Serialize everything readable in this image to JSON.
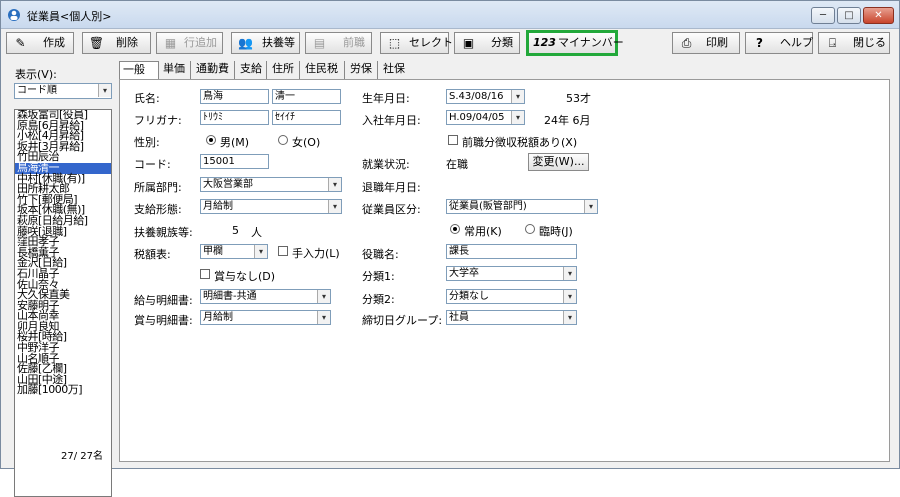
{
  "window": {
    "title": "従業員<個人別>",
    "min": "─",
    "max": "□",
    "close": "✕"
  },
  "toolbar": {
    "create": "作成",
    "delete": "削除",
    "add_row": "行追加",
    "dependents": "扶養等",
    "prev_job": "前職",
    "select": "セレクト",
    "category": "分類",
    "mynumber": "マイナンバー",
    "mynumber_icon": "123",
    "print": "印刷",
    "help": "ヘルプ",
    "close": "閉じる"
  },
  "left": {
    "display_label": "表示(V):",
    "sort_value": "コード順",
    "count": "27/ 27名",
    "employees": [
      "森坂富司[役員]",
      "原島[6月昇給]",
      "小松[4月昇給]",
      "坂井[3月昇給]",
      "竹田辰治",
      "鳥海清一",
      "中村[休職(有)]",
      "田所耕太郎",
      "竹下[郵便局]",
      "坂本[休職(無)]",
      "萩原[日給月給]",
      "藤咲[退職]",
      "窪田孝子",
      "長橋薫子",
      "金沢[日給]",
      "石川晶子",
      "佐山奈々",
      "大久保直美",
      "安藤明子",
      "山本尚幸",
      "卯月良知",
      "桜井[時給]",
      "中野洋子",
      "山名順子",
      "佐藤[乙欄]",
      "山田[中途]",
      "加藤[1000万]"
    ],
    "selected_index": 5
  },
  "tabs": [
    "一般",
    "単価",
    "通勤費",
    "支給",
    "住所",
    "住民税",
    "労保",
    "社保"
  ],
  "form": {
    "name_label": "氏名:",
    "last_name": "鳥海",
    "first_name": "清一",
    "kana_label": "フリガナ:",
    "last_kana": "ﾄﾘｳﾐ",
    "first_kana": "ｾｲｲﾁ",
    "sex_label": "性別:",
    "male": "男(M)",
    "female": "女(O)",
    "code_label": "コード:",
    "code": "15001",
    "dept_label": "所属部門:",
    "dept": "大阪営業部",
    "pay_form_label": "支給形態:",
    "pay_form": "月給制",
    "dep_label": "扶養親族等:",
    "dep_count": "5",
    "dep_unit": "人",
    "tax_label": "税額表:",
    "tax": "甲欄",
    "manual_input": "手入力(L)",
    "no_bonus": "賞与なし(D)",
    "slip_label": "給与明細書:",
    "slip": "明細書-共通",
    "bonus_slip_label": "賞与明細書:",
    "bonus_slip": "月給制",
    "birth_label": "生年月日:",
    "birth": "S.43/08/16",
    "age": "53才",
    "join_label": "入社年月日:",
    "join": "H.09/04/05",
    "tenure": "24年 6月",
    "prev_tax": "前職分徴収税額あり(X)",
    "status_label": "就業状況:",
    "status": "在職",
    "change_btn": "変更(W)...",
    "retire_label": "退職年月日:",
    "emp_class_label": "従業員区分:",
    "emp_class": "従業員(販管部門)",
    "regular": "常用(K)",
    "temp": "臨時(J)",
    "title_label": "役職名:",
    "title": "課長",
    "class1_label": "分類1:",
    "class1": "大学卒",
    "class2_label": "分類2:",
    "class2": "分類なし",
    "group_label": "締切日グループ:",
    "group": "社員"
  }
}
